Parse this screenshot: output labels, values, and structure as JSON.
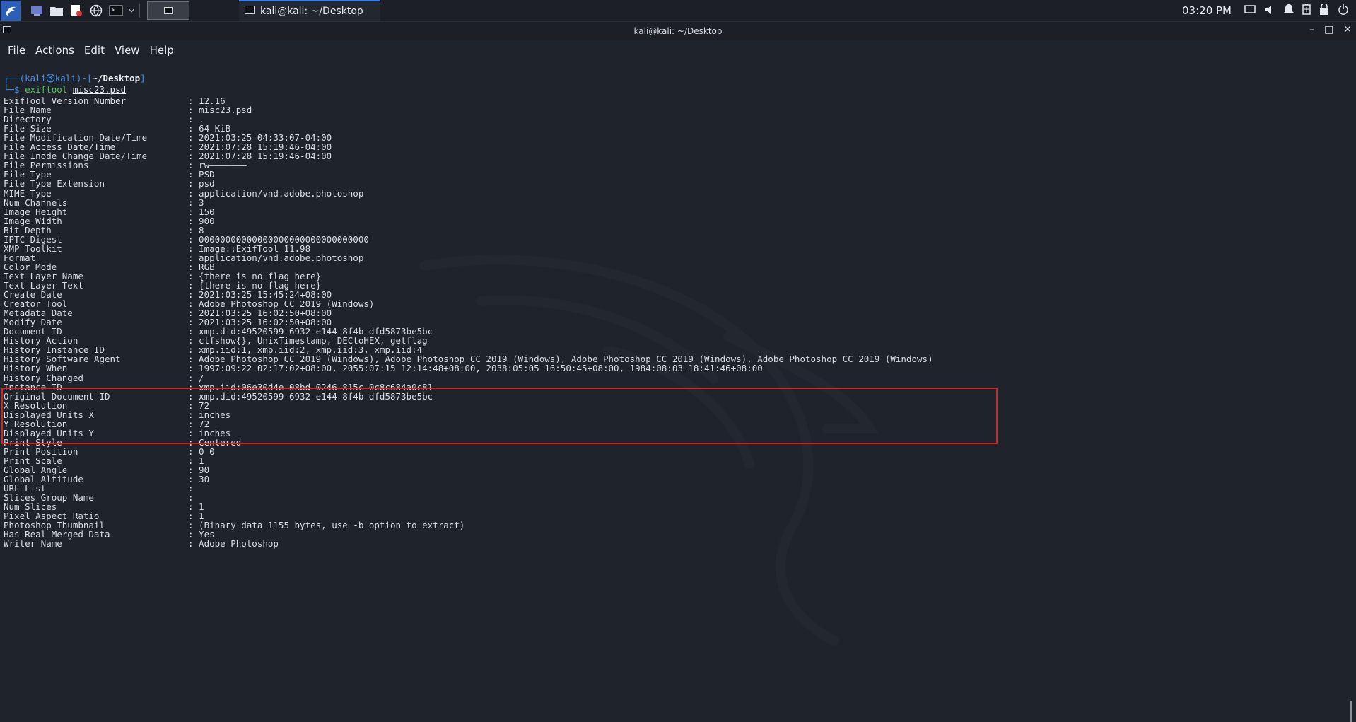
{
  "panel": {
    "clock": "03:20 PM",
    "task_title": "kali@kali: ~/Desktop"
  },
  "window": {
    "title": "kali@kali: ~/Desktop",
    "controls": [
      "–",
      "□",
      "✕"
    ]
  },
  "menu": [
    "File",
    "Actions",
    "Edit",
    "View",
    "Help"
  ],
  "prompt": {
    "user": "kali",
    "at": "㉿",
    "host": "kali",
    "path": "~/Desktop",
    "command": "exiftool",
    "argument": "misc23.psd"
  },
  "rows": [
    {
      "k": "ExifTool Version Number",
      "v": ": 12.16"
    },
    {
      "k": "File Name",
      "v": ": misc23.psd"
    },
    {
      "k": "Directory",
      "v": ": ."
    },
    {
      "k": "File Size",
      "v": ": 64 KiB"
    },
    {
      "k": "File Modification Date/Time",
      "v": ": 2021:03:25 04:33:07-04:00"
    },
    {
      "k": "File Access Date/Time",
      "v": ": 2021:07:28 15:19:46-04:00"
    },
    {
      "k": "File Inode Change Date/Time",
      "v": ": 2021:07:28 15:19:46-04:00"
    },
    {
      "k": "File Permissions",
      "v": ": rw———————"
    },
    {
      "k": "File Type",
      "v": ": PSD"
    },
    {
      "k": "File Type Extension",
      "v": ": psd"
    },
    {
      "k": "MIME Type",
      "v": ": application/vnd.adobe.photoshop"
    },
    {
      "k": "Num Channels",
      "v": ": 3"
    },
    {
      "k": "Image Height",
      "v": ": 150"
    },
    {
      "k": "Image Width",
      "v": ": 900"
    },
    {
      "k": "Bit Depth",
      "v": ": 8"
    },
    {
      "k": "IPTC Digest",
      "v": ": 00000000000000000000000000000000"
    },
    {
      "k": "XMP Toolkit",
      "v": ": Image::ExifTool 11.98"
    },
    {
      "k": "Format",
      "v": ": application/vnd.adobe.photoshop"
    },
    {
      "k": "Color Mode",
      "v": ": RGB"
    },
    {
      "k": "Text Layer Name",
      "v": ": {there is no flag here}"
    },
    {
      "k": "Text Layer Text",
      "v": ": {there is no flag here}"
    },
    {
      "k": "Create Date",
      "v": ": 2021:03:25 15:45:24+08:00"
    },
    {
      "k": "Creator Tool",
      "v": ": Adobe Photoshop CC 2019 (Windows)"
    },
    {
      "k": "Metadata Date",
      "v": ": 2021:03:25 16:02:50+08:00"
    },
    {
      "k": "Modify Date",
      "v": ": 2021:03:25 16:02:50+08:00"
    },
    {
      "k": "Document ID",
      "v": ": xmp.did:49520599-6932-e144-8f4b-dfd5873be5bc"
    },
    {
      "k": "History Action",
      "v": ": ctfshow{}, UnixTimestamp, DECtoHEX, getflag"
    },
    {
      "k": "History Instance ID",
      "v": ": xmp.iid:1, xmp.iid:2, xmp.iid:3, xmp.iid:4"
    },
    {
      "k": "History Software Agent",
      "v": ": Adobe Photoshop CC 2019 (Windows), Adobe Photoshop CC 2019 (Windows), Adobe Photoshop CC 2019 (Windows), Adobe Photoshop CC 2019 (Windows)"
    },
    {
      "k": "History When",
      "v": ": 1997:09:22 02:17:02+08:00, 2055:07:15 12:14:48+08:00, 2038:05:05 16:50:45+08:00, 1984:08:03 18:41:46+08:00"
    },
    {
      "k": "History Changed",
      "v": ": /"
    },
    {
      "k": "Instance ID",
      "v": ": xmp.iid:06e30d4e-08bd-0246-815c-0c8c684a0c81"
    },
    {
      "k": "Original Document ID",
      "v": ": xmp.did:49520599-6932-e144-8f4b-dfd5873be5bc"
    },
    {
      "k": "X Resolution",
      "v": ": 72"
    },
    {
      "k": "Displayed Units X",
      "v": ": inches"
    },
    {
      "k": "Y Resolution",
      "v": ": 72"
    },
    {
      "k": "Displayed Units Y",
      "v": ": inches"
    },
    {
      "k": "Print Style",
      "v": ": Centered"
    },
    {
      "k": "Print Position",
      "v": ": 0 0"
    },
    {
      "k": "Print Scale",
      "v": ": 1"
    },
    {
      "k": "Global Angle",
      "v": ": 90"
    },
    {
      "k": "Global Altitude",
      "v": ": 30"
    },
    {
      "k": "URL List",
      "v": ":"
    },
    {
      "k": "Slices Group Name",
      "v": ":"
    },
    {
      "k": "Num Slices",
      "v": ": 1"
    },
    {
      "k": "Pixel Aspect Ratio",
      "v": ": 1"
    },
    {
      "k": "Photoshop Thumbnail",
      "v": ": (Binary data 1155 bytes, use -b option to extract)"
    },
    {
      "k": "Has Real Merged Data",
      "v": ": Yes"
    },
    {
      "k": "Writer Name",
      "v": ": Adobe Photoshop"
    }
  ],
  "colors": {
    "background": "#1f232b",
    "highlight_box": "#d3232a",
    "prompt_blue": "#3b8eea",
    "command_green": "#4fc35c"
  }
}
